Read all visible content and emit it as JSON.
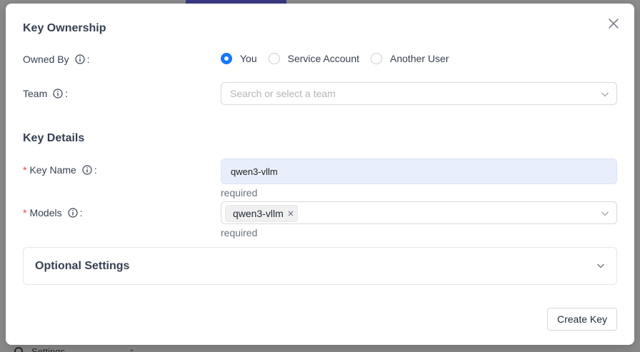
{
  "backdrop": {
    "settings_label": "Settings"
  },
  "modal": {
    "ownership": {
      "title": "Key Ownership",
      "owned_by_label": "Owned By",
      "owned_by_options": [
        {
          "label": "You",
          "checked": true
        },
        {
          "label": "Service Account",
          "checked": false
        },
        {
          "label": "Another User",
          "checked": false
        }
      ],
      "team_label": "Team",
      "team_placeholder": "Search or select a team"
    },
    "details": {
      "title": "Key Details",
      "key_name_label": "Key Name",
      "key_name_value": "qwen3-vllm",
      "key_name_helper": "required",
      "models_label": "Models",
      "models_selected": [
        "qwen3-vllm"
      ],
      "models_helper": "required"
    },
    "optional_settings_label": "Optional Settings",
    "create_button_label": "Create Key",
    "required_marker": "*",
    "colon": ":"
  },
  "colors": {
    "accent": "#1677ff",
    "required": "#ef4444",
    "input_filled_bg": "#e8eefb"
  },
  "icons": {
    "close": "close-icon",
    "info": "info-circle-icon",
    "chevron": "chevron-down-icon",
    "tag_remove": "tag-close-icon"
  }
}
